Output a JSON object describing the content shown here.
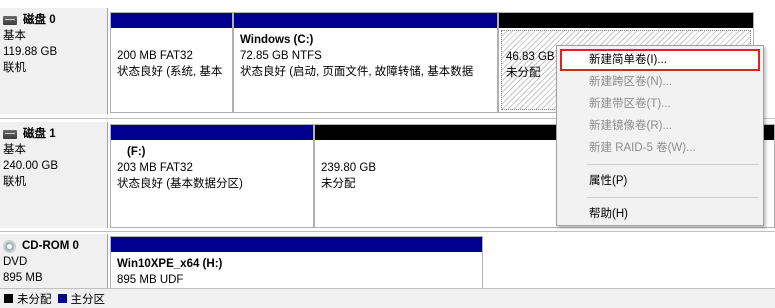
{
  "disks": [
    {
      "name": "磁盘 0",
      "type": "基本",
      "size": "119.88 GB",
      "status": "联机",
      "partitions": [
        {
          "name": "",
          "size": "200 MB FAT32",
          "status": "状态良好 (系统, 基本"
        },
        {
          "name": "Windows  (C:)",
          "size": "72.85 GB NTFS",
          "status": "状态良好 (启动, 页面文件, 故障转储, 基本数据"
        },
        {
          "name": "",
          "size": "46.83 GB",
          "status": "未分配"
        }
      ]
    },
    {
      "name": "磁盘 1",
      "type": "基本",
      "size": "240.00 GB",
      "status": "联机",
      "partitions": [
        {
          "name": "(F:)",
          "size": "203 MB FAT32",
          "status": "状态良好 (基本数据分区)"
        },
        {
          "name": "",
          "size": "239.80 GB",
          "status": "未分配"
        }
      ]
    },
    {
      "name": "CD-ROM 0",
      "type": "DVD",
      "size": "895 MB",
      "status": "",
      "partitions": [
        {
          "name": "Win10XPE_x64  (H:)",
          "size": "895 MB UDF",
          "status": ""
        }
      ]
    }
  ],
  "context_menu": {
    "items": [
      {
        "label": "新建简单卷(I)...",
        "enabled": true,
        "highlighted": true
      },
      {
        "label": "新建跨区卷(N)...",
        "enabled": false
      },
      {
        "label": "新建带区卷(T)...",
        "enabled": false
      },
      {
        "label": "新建镜像卷(R)...",
        "enabled": false
      },
      {
        "label": "新建 RAID-5 卷(W)...",
        "enabled": false
      },
      {
        "label": "属性(P)",
        "enabled": true
      },
      {
        "label": "帮助(H)",
        "enabled": true
      }
    ]
  },
  "legend": [
    {
      "label": "未分配",
      "color": "#000000"
    },
    {
      "label": "主分区",
      "color": "#000090"
    }
  ]
}
